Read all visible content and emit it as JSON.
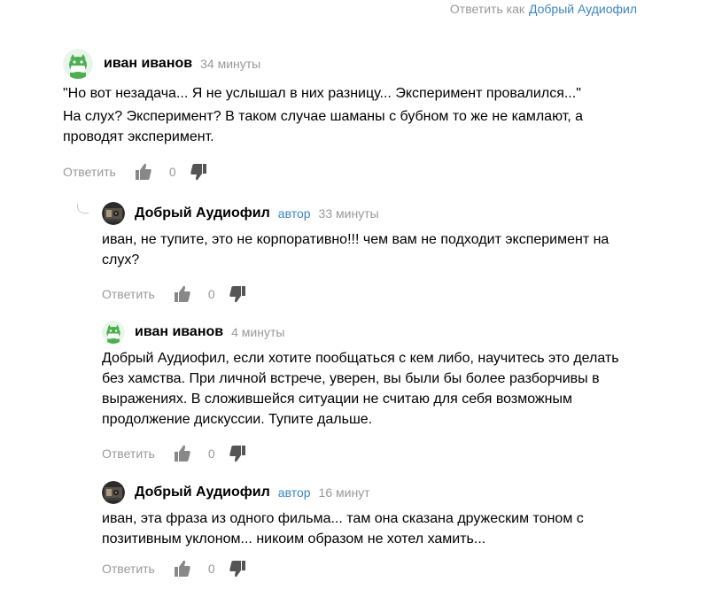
{
  "header": {
    "reply_as_prefix": "Ответить как",
    "reply_as_user": "Добрый Аудиофил"
  },
  "colors": {
    "link": "#3a86c8",
    "muted": "#999999",
    "avatar_green": "#4caf50"
  },
  "icons": {
    "like": "thumbs-up-icon",
    "dislike": "thumbs-down-icon"
  },
  "comments": [
    {
      "author": "иван иванов",
      "badge": "",
      "time": "34 минуты",
      "avatar": "green-mask-avatar",
      "paragraphs": [
        "\"Но вот незадача... Я не услышал в них разницу... Эксперимент провалился...\"",
        "На слух? Эксперимент? В таком случае шаманы с бубном то же не камлают, а проводят эксперимент."
      ],
      "reply_label": "Ответить",
      "votes": "0"
    },
    {
      "author": "Добрый Аудиофил",
      "badge": "автор",
      "time": "33 минуты",
      "avatar": "audio-equipment-avatar",
      "paragraphs": [
        "иван, не тупите, это не корпоративно!!! чем вам не подходит эксперимент на слух?"
      ],
      "reply_label": "Ответить",
      "votes": "0"
    },
    {
      "author": "иван иванов",
      "badge": "",
      "time": "4 минуты",
      "avatar": "green-mask-avatar",
      "paragraphs": [
        "Добрый Аудиофил, если хотите пообщаться с кем либо, научитесь это делать без хамства. При личной встрече, уверен, вы были бы более разборчивы в выражениях. В сложившейся ситуации не считаю для себя возможным продолжение дискуссии. Тупите дальше."
      ],
      "reply_label": "Ответить",
      "votes": "0"
    },
    {
      "author": "Добрый Аудиофил",
      "badge": "автор",
      "time": "16 минут",
      "avatar": "audio-equipment-avatar",
      "paragraphs": [
        "иван, эта фраза из одного фильма... там она сказана дружеским тоном с позитивным уклоном... никоим образом не хотел хамить..."
      ],
      "reply_label": "Ответить",
      "votes": "0"
    }
  ]
}
